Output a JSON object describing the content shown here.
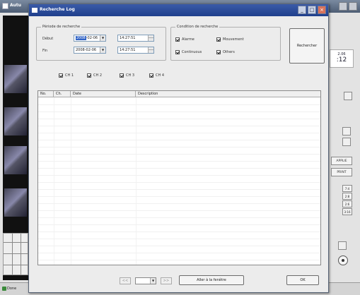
{
  "background_app": {
    "title": "Autu",
    "clock": {
      "date": "2.06",
      "time": ":12"
    },
    "buttons": [
      "APPLIE",
      "PRINT"
    ],
    "small_buttons": [
      "7:4",
      "2:8",
      "2:6",
      "3:16"
    ],
    "status_label": "Done"
  },
  "dialog": {
    "title": "Recherche Log",
    "period": {
      "legend": "Période de recherche",
      "start_label": "Début",
      "end_label": "Fin",
      "start_date_selected": "2008",
      "start_date_rest": "-02-06",
      "start_time": "14:27:51",
      "end_date": "2008-02-06",
      "end_time": "14:27:51"
    },
    "condition": {
      "legend": "Condition de recherche",
      "options": [
        {
          "label": "Alarme",
          "checked": true
        },
        {
          "label": "Mouvement",
          "checked": true
        },
        {
          "label": "Continuous",
          "checked": true
        },
        {
          "label": "Others",
          "checked": true
        }
      ]
    },
    "search_button": "Rechercher",
    "channels": [
      {
        "label": "CH 1",
        "checked": true
      },
      {
        "label": "CH 2",
        "checked": true
      },
      {
        "label": "CH 3",
        "checked": true
      },
      {
        "label": "CH 4",
        "checked": true
      }
    ],
    "columns": [
      "No.",
      "Ch.",
      "Date",
      "Description"
    ],
    "pager": {
      "prev": "<<",
      "next": ">>"
    },
    "goto_button": "Aller à la fenêtre",
    "ok_button": "OK"
  },
  "colors": {
    "dialog_title_bar": "#2a4c9c",
    "selection": "#3163c5"
  }
}
